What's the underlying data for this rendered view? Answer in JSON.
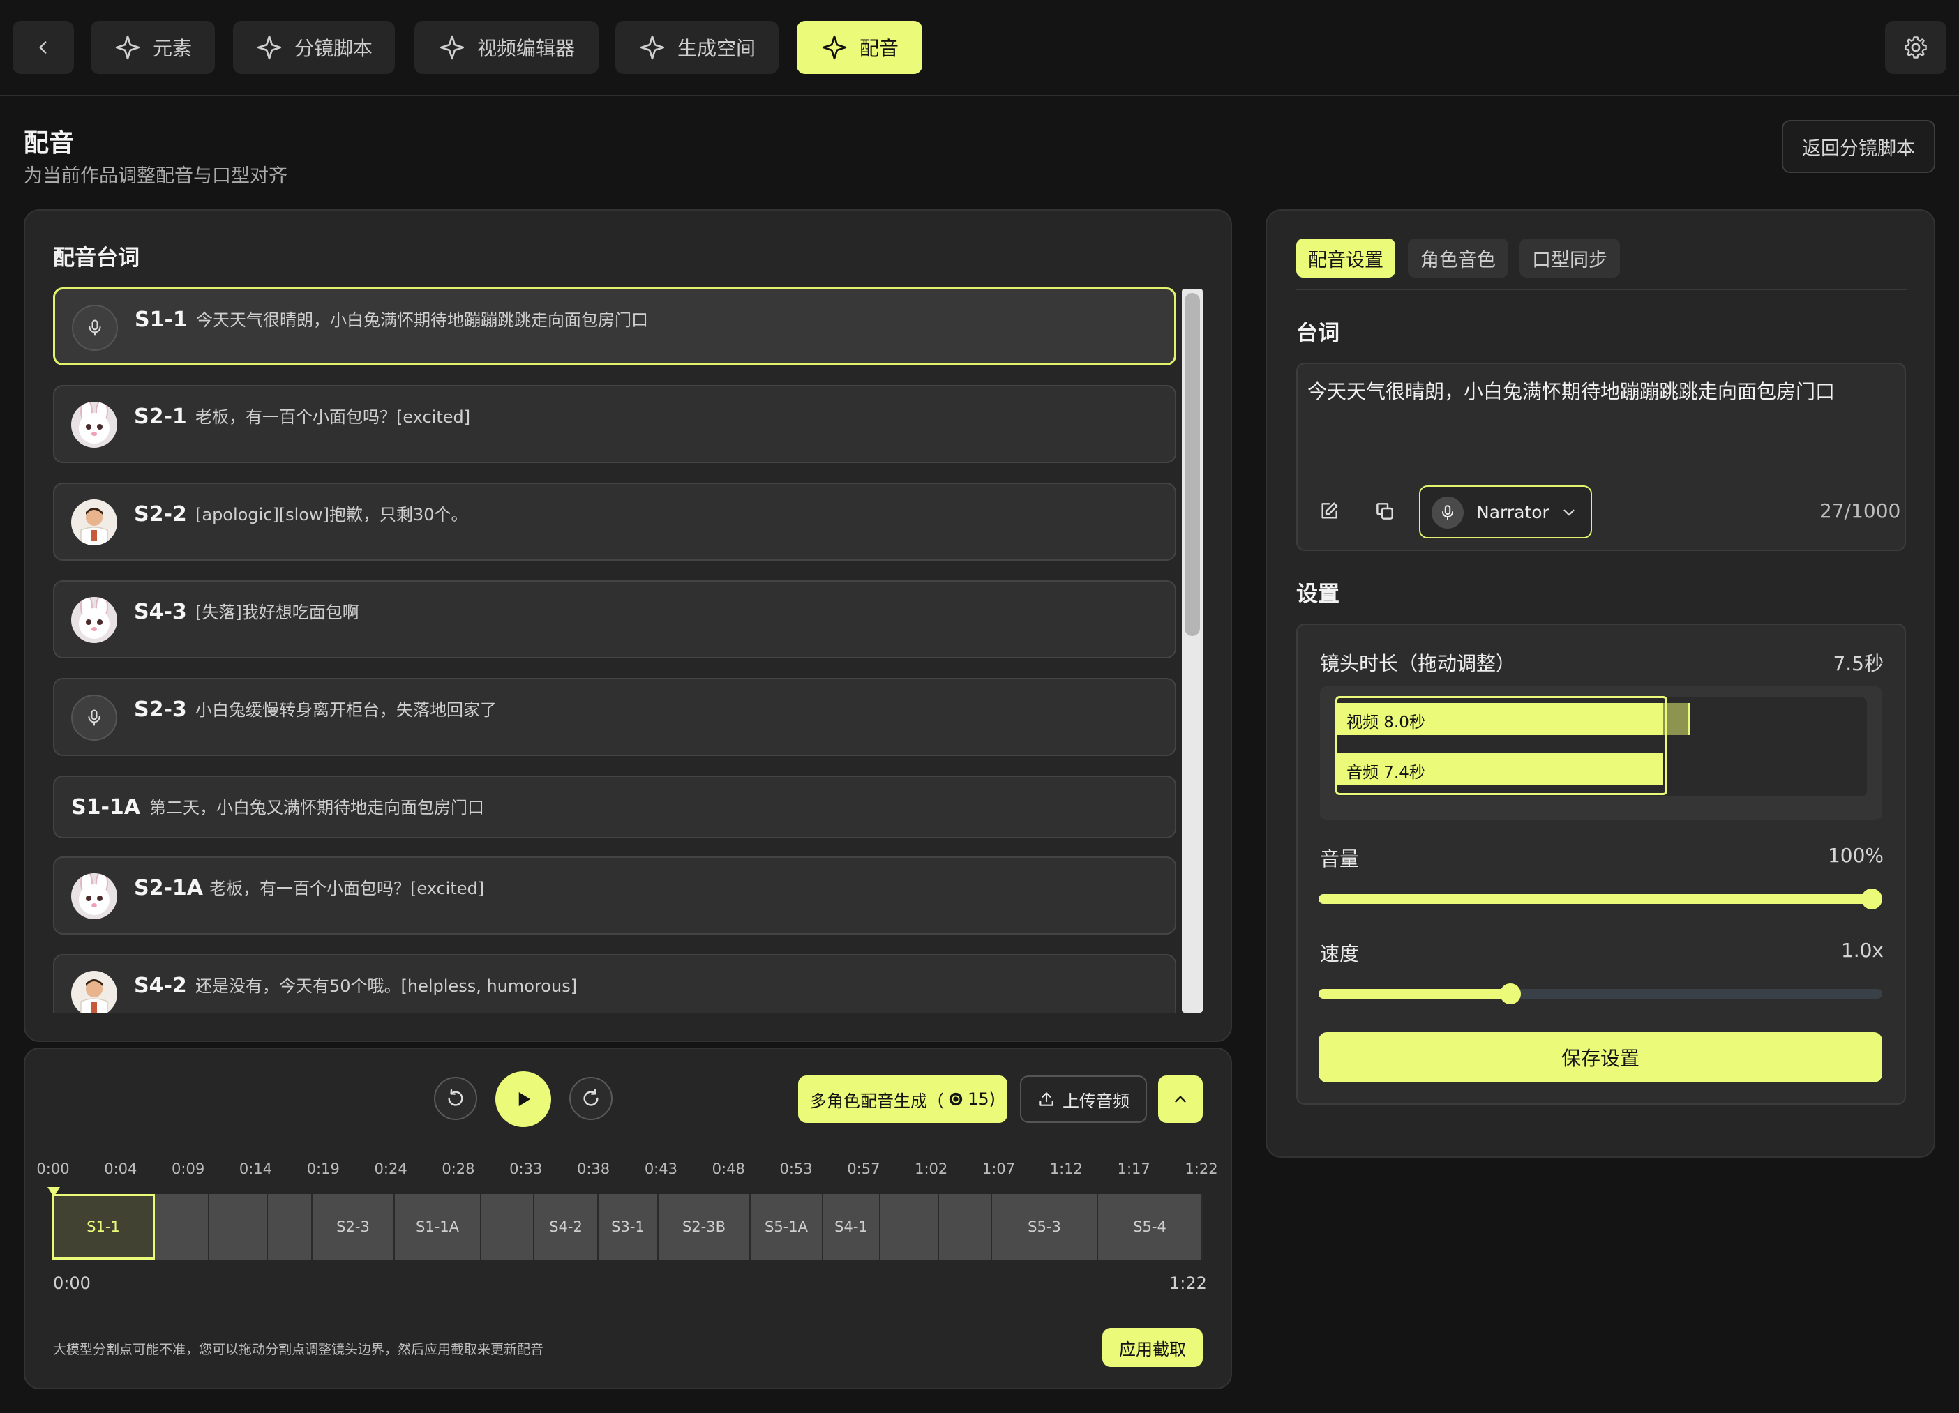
{
  "nav": {
    "tabs": [
      {
        "label": "元素",
        "icon": "sparkle-icon"
      },
      {
        "label": "分镜脚本",
        "icon": "sparkle-icon"
      },
      {
        "label": "视频编辑器",
        "icon": "sparkle-icon"
      },
      {
        "label": "生成空间",
        "icon": "sparkle-icon"
      },
      {
        "label": "配音",
        "icon": "sparkle-icon",
        "active": true
      }
    ]
  },
  "header": {
    "title": "配音",
    "subtitle": "为当前作品调整配音与口型对齐",
    "return_button": "返回分镜脚本"
  },
  "dialogue": {
    "heading": "配音台词",
    "items": [
      {
        "id": "S1-1",
        "text": "今天天气很晴朗，小白兔满怀期待地蹦蹦跳跳走向面包房门口",
        "avatar": "mic",
        "active": true
      },
      {
        "id": "S2-1",
        "text": "老板，有一百个小面包吗？[excited]",
        "avatar": "rabbit"
      },
      {
        "id": "S2-2",
        "text": "[apologic][slow]抱歉，只剩30个。",
        "avatar": "baker"
      },
      {
        "id": "S4-3",
        "text": "[失落]我好想吃面包啊",
        "avatar": "rabbit"
      },
      {
        "id": "S2-3",
        "text": "小白兔缓慢转身离开柜台，失落地回家了",
        "avatar": "mic"
      },
      {
        "id": "S1-1A",
        "text": "第二天，小白兔又满怀期待地走向面包房门口",
        "avatar": "none"
      },
      {
        "id": "S2-1A",
        "text": "老板，有一百个小面包吗？[excited]",
        "avatar": "rabbit"
      },
      {
        "id": "S4-2",
        "text": "还是没有，今天有50个哦。[helpless, humorous]",
        "avatar": "baker"
      }
    ]
  },
  "timeline": {
    "multi_role_button": "多角色配音生成（",
    "multi_role_credits": "15)",
    "upload_button": "上传音频",
    "ticks": [
      "0:00",
      "0:04",
      "0:09",
      "0:14",
      "0:19",
      "0:24",
      "0:28",
      "0:33",
      "0:38",
      "0:43",
      "0:48",
      "0:53",
      "0:57",
      "1:02",
      "1:07",
      "1:12",
      "1:17",
      "1:22"
    ],
    "segments": [
      "S1-1",
      "",
      "",
      "",
      "S2-3",
      "S1-1A",
      "",
      "S4-2",
      "S3-1",
      "S2-3B",
      "S5-1A",
      "S4-1",
      "",
      "",
      "S5-3",
      "S5-4"
    ],
    "start_time": "0:00",
    "end_time": "1:22",
    "hint": "大模型分割点可能不准，您可以拖动分割点调整镜头边界，然后应用截取来更新配音",
    "apply_button": "应用截取"
  },
  "settings_panel": {
    "tabs": [
      "配音设置",
      "角色音色",
      "口型同步"
    ],
    "script_heading": "台词",
    "script_text": "今天天气很晴朗，小白兔满怀期待地蹦蹦跳跳走向面包房门口",
    "voice": "Narrator",
    "char_count": "27/1000",
    "settings_heading": "设置",
    "shot_duration_label": "镜头时长（拖动调整）",
    "shot_duration_value": "7.5秒",
    "video_bar_label": "视频 8.0秒",
    "audio_bar_label": "音频 7.4秒",
    "volume_label": "音量",
    "volume_value": "100%",
    "volume_fraction": 1.0,
    "speed_label": "速度",
    "speed_value": "1.0x",
    "speed_fraction": 0.34,
    "save_button": "保存设置"
  },
  "colors": {
    "accent": "#ebfb79",
    "background": "#141414",
    "panel": "#262626"
  }
}
